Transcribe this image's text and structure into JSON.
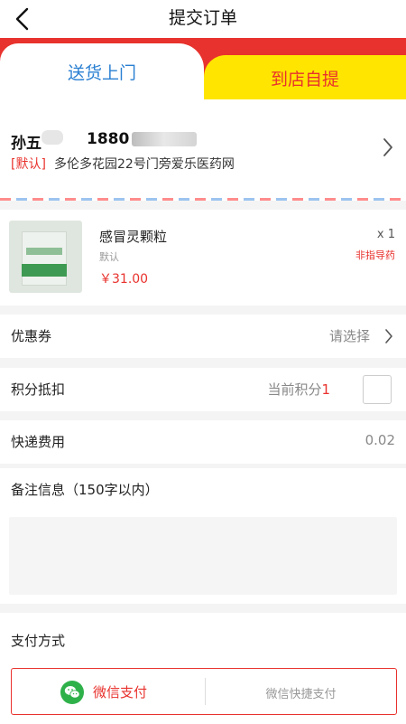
{
  "header": {
    "title": "提交订单"
  },
  "tabs": {
    "delivery": "送货上门",
    "pickup": "到店自提"
  },
  "address": {
    "name": "孙五",
    "phone": "1880",
    "tag": "[默认]",
    "detail": "多伦多花园22号门旁爱乐医药网"
  },
  "product": {
    "name": "感冒灵颗粒",
    "spec": "默认",
    "price": "￥31.00",
    "quantity": "x 1",
    "badge": "非指导药"
  },
  "coupon": {
    "label": "优惠券",
    "value": "请选择"
  },
  "points": {
    "label": "积分抵扣",
    "text": "当前积分",
    "value": "1",
    "checked": false
  },
  "shipping": {
    "label": "快递费用",
    "value": "0.02"
  },
  "remarks": {
    "label": "备注信息（150字以内）",
    "value": ""
  },
  "payment": {
    "label": "支付方式",
    "options": [
      "微信支付",
      "微信快捷支付"
    ],
    "selected": "微信支付"
  },
  "colors": {
    "accent_red": "#e8322d",
    "tab_yellow": "#ffe500",
    "tab_blue": "#2a7fd2",
    "wechat_green": "#2fb14a"
  },
  "icons": {
    "back": "chevron-left-icon",
    "arrow": "chevron-right-icon",
    "wechat": "wechat-icon"
  }
}
